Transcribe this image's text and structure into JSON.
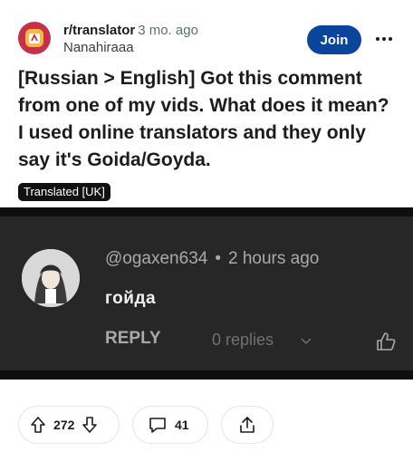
{
  "post": {
    "subreddit": "r/translator",
    "age": "3 mo. ago",
    "username": "Nanahiraaa",
    "join_label": "Join",
    "title": "[Russian > English] Got this comment from one of my vids. What does it mean? I used online translators and they only say it's Goida/Goyda.",
    "flair": "Translated [UK]"
  },
  "embed": {
    "author": "@ogaxen634",
    "separator": "•",
    "time": "2 hours ago",
    "comment": "гойда",
    "reply_label": "REPLY",
    "replies_label": "0 replies"
  },
  "actions": {
    "votes": "272",
    "comments": "41"
  },
  "colors": {
    "join": "#0a449b",
    "subreddit_icon": "#c6304a",
    "embed_bg": "#272727"
  },
  "icons": {
    "subreddit": "translator-icon",
    "more": "more-icon",
    "upvote": "upvote-icon",
    "downvote": "downvote-icon",
    "comment": "comment-icon",
    "share": "share-icon",
    "chevron": "chevron-down-icon",
    "like": "thumbs-up-icon"
  }
}
